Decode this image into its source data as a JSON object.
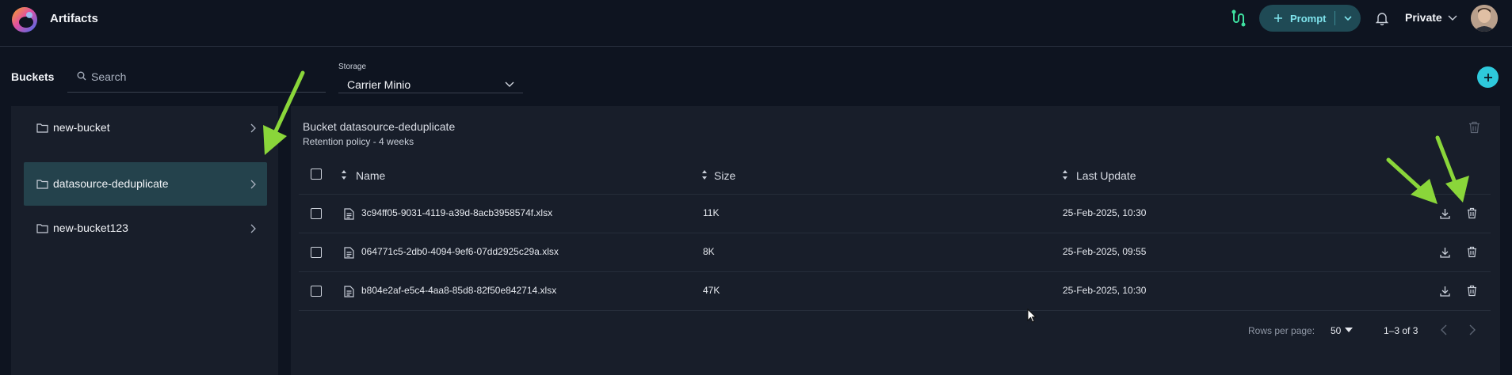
{
  "app": {
    "title": "Artifacts"
  },
  "header": {
    "prompt_label": "Prompt",
    "visibility_label": "Private",
    "accent_color": "#7fe3ec"
  },
  "toolbar": {
    "buckets_label": "Buckets",
    "search_placeholder": "Search",
    "storage_label": "Storage",
    "storage_value": "Carrier Minio"
  },
  "sidebar": {
    "items": [
      {
        "label": "new-bucket",
        "active": false
      },
      {
        "label": "datasource-deduplicate",
        "active": true
      },
      {
        "label": "new-bucket123",
        "active": false
      }
    ]
  },
  "bucket": {
    "title": "Bucket datasource-deduplicate",
    "retention": "Retention policy - 4 weeks"
  },
  "table": {
    "columns": [
      "Name",
      "Size",
      "Last Update"
    ],
    "rows": [
      {
        "name": "3c94ff05-9031-4119-a39d-8acb3958574f.xlsx",
        "size": "11K",
        "updated": "25-Feb-2025, 10:30"
      },
      {
        "name": "064771c5-2db0-4094-9ef6-07dd2925c29a.xlsx",
        "size": "8K",
        "updated": "25-Feb-2025, 09:55"
      },
      {
        "name": "b804e2af-e5c4-4aa8-85d8-82f50e842714.xlsx",
        "size": "47K",
        "updated": "25-Feb-2025, 10:30"
      }
    ]
  },
  "pagination": {
    "rows_per_page_label": "Rows per page:",
    "rows_per_page_value": "50",
    "range": "1–3 of 3"
  },
  "icons": [
    "logo",
    "flow-icon",
    "plus-icon",
    "chevron-down-icon",
    "bell-icon",
    "avatar",
    "search-icon",
    "folder-icon",
    "chevron-right-icon",
    "trash-icon",
    "sort-icon",
    "file-icon",
    "download-icon",
    "chevron-left-icon"
  ]
}
